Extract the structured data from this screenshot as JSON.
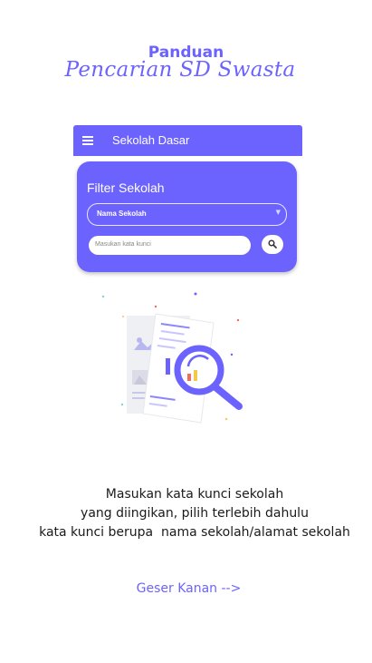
{
  "header": {
    "title": "Panduan",
    "subtitle": "Pencarian SD Swasta"
  },
  "mockup": {
    "app_bar_title": "Sekolah Dasar",
    "card_title": "Filter Sekolah",
    "select_value": "Nama Sekolah",
    "search_placeholder": "Masukan kata kunci"
  },
  "description": {
    "line1": "Masukan kata kunci sekolah",
    "line2": "yang diingikan, pilih terlebih dahulu",
    "line3": "kata kunci berupa  nama sekolah/alamat sekolah"
  },
  "swipe_hint": "Geser Kanan -->",
  "colors": {
    "accent": "#6c63ff"
  }
}
